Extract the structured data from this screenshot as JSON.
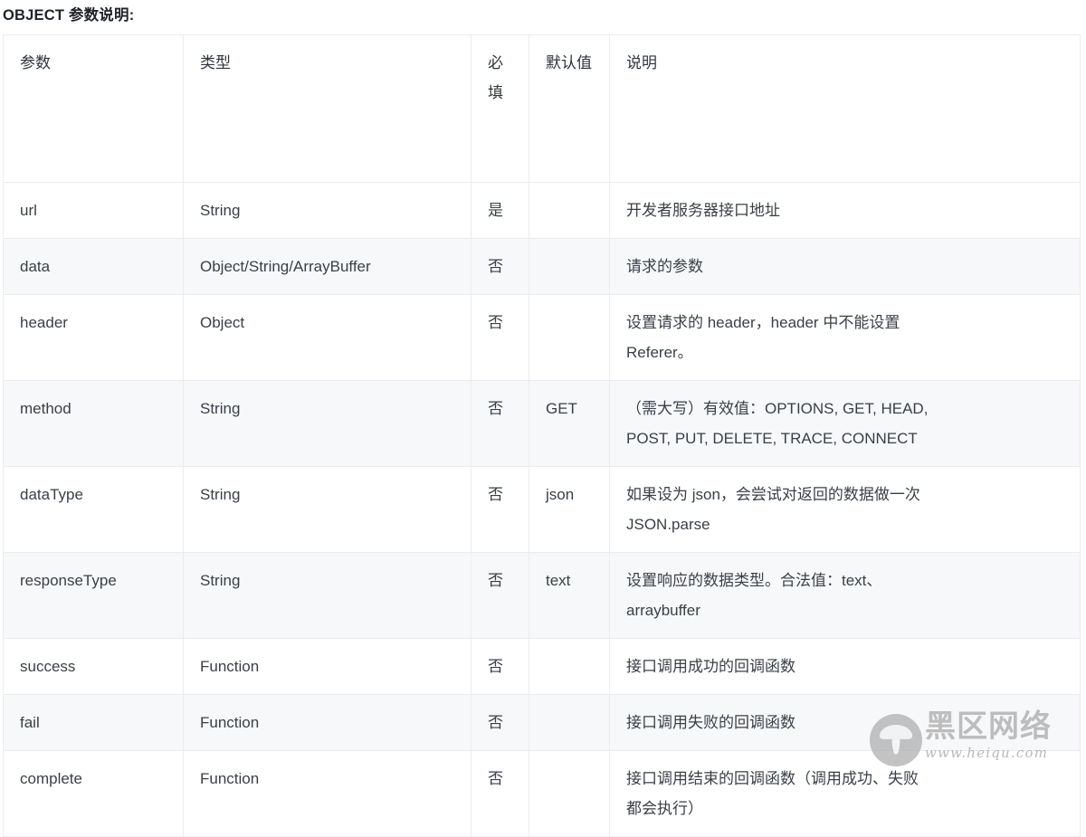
{
  "page": {
    "title": "OBJECT 参数说明:"
  },
  "table": {
    "headers": [
      {
        "label": "参数",
        "key": "param"
      },
      {
        "label": "类型",
        "key": "type"
      },
      {
        "label": "必填",
        "key": "required"
      },
      {
        "label": "默认值",
        "key": "default"
      },
      {
        "label": "说明",
        "key": "desc"
      }
    ],
    "rows": [
      {
        "param": "url",
        "type": "String",
        "required": "是",
        "default": "",
        "desc": [
          "开发者服务器接口地址"
        ]
      },
      {
        "param": "data",
        "type": "Object/String/ArrayBuffer",
        "required": "否",
        "default": "",
        "desc": [
          "请求的参数"
        ]
      },
      {
        "param": "header",
        "type": "Object",
        "required": "否",
        "default": "",
        "desc": [
          "设置请求的 header，header 中不能设置",
          "Referer。"
        ]
      },
      {
        "param": "method",
        "type": "String",
        "required": "否",
        "default": "GET",
        "desc": [
          "（需大写）有效值：OPTIONS, GET, HEAD,",
          "POST, PUT, DELETE, TRACE, CONNECT"
        ]
      },
      {
        "param": "dataType",
        "type": "String",
        "required": "否",
        "default": "json",
        "desc": [
          "如果设为 json，会尝试对返回的数据做一次",
          "JSON.parse"
        ]
      },
      {
        "param": "responseType",
        "type": "String",
        "required": "否",
        "default": "text",
        "desc": [
          "设置响应的数据类型。合法值：text、",
          "arraybuffer"
        ]
      },
      {
        "param": "success",
        "type": "Function",
        "required": "否",
        "default": "",
        "desc": [
          "接口调用成功的回调函数"
        ]
      },
      {
        "param": "fail",
        "type": "Function",
        "required": "否",
        "default": "",
        "desc": [
          "接口调用失败的回调函数"
        ]
      },
      {
        "param": "complete",
        "type": "Function",
        "required": "否",
        "default": "",
        "desc": [
          "接口调用结束的回调函数（调用成功、失败",
          "都会执行）"
        ]
      }
    ]
  },
  "watermark": {
    "brand": "黑区网络",
    "url": "www.heiqu.com",
    "logo_icon": "mushroom-icon"
  },
  "colors": {
    "text": "#3a3f47",
    "border": "#ececef",
    "row_alt_bg": "#f7f8fa",
    "row_bg": "#ffffff",
    "watermark": "#9a9a9a"
  }
}
